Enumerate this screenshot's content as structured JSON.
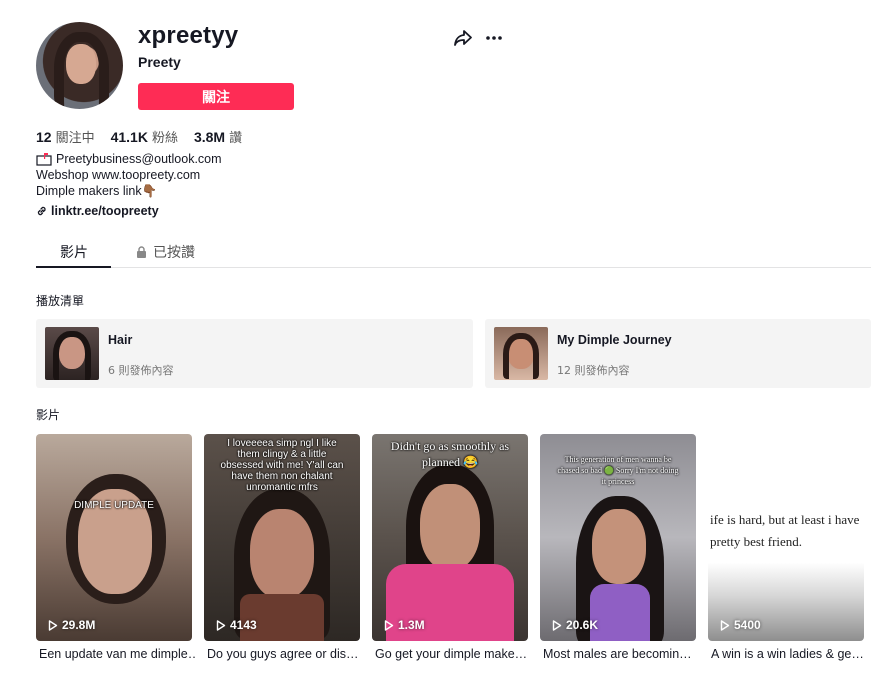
{
  "profile": {
    "username": "xpreetyy",
    "nickname": "Preety",
    "follow_label": "關注"
  },
  "stats": {
    "following": "12",
    "following_label": "關注中",
    "followers": "41.1K",
    "followers_label": "粉絲",
    "likes": "3.8M",
    "likes_label": "讚"
  },
  "bio": {
    "line1": "Preetybusiness@outlook.com",
    "line2": "Webshop www.toopreety.com",
    "line3": "Dimple makers link👇🏾",
    "link": "linktr.ee/toopreety"
  },
  "tabs": {
    "videos": "影片",
    "liked": "已按讚"
  },
  "sections": {
    "playlists": "播放清單",
    "videos": "影片"
  },
  "playlists": [
    {
      "title": "Hair",
      "count": "6 則發佈內容"
    },
    {
      "title": "My Dimple Journey",
      "count": "12 則發佈內容"
    }
  ],
  "videos": [
    {
      "views": "29.8M",
      "caption": "Een update van me dimple…",
      "overlay": "DIMPLE UPDATE"
    },
    {
      "views": "4143",
      "caption": "Do you guys agree or dis…",
      "overlay": "I loveeeea simp ngl I like them clingy & a little obsessed with me! Y'all can have them non chalant unromantic mfrs"
    },
    {
      "views": "1.3M",
      "caption": "Go get your dimple make…",
      "overlay": "Didn't go as smoothly as planned 😂"
    },
    {
      "views": "20.6K",
      "caption": "Most males are becomin…",
      "overlay": "This generation of men wanna be chased so bad 🟢 Sorry I'm not doing it princess"
    },
    {
      "views": "5400",
      "caption": "A win is a win ladies & ge…",
      "overlay": "ife is hard, but at least i have pretty best friend."
    }
  ],
  "icons": {
    "share": "share-icon",
    "more": "more-icon",
    "lock": "lock-icon",
    "link": "link-icon",
    "mailbox": "mailbox-icon",
    "play": "play-icon"
  },
  "colors": {
    "accent": "#fe2c55",
    "text": "#161823",
    "muted": "#777777"
  }
}
